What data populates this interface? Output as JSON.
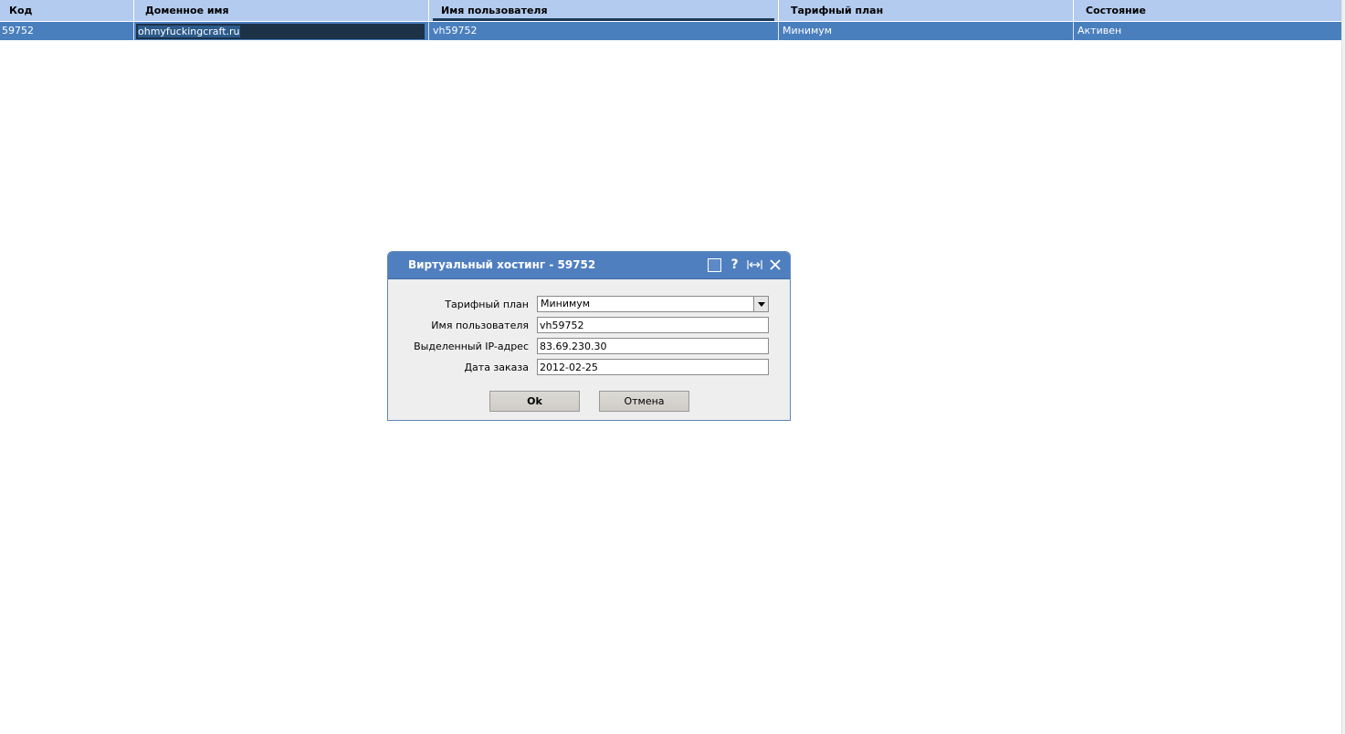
{
  "table": {
    "columns": [
      "Код",
      "Доменное имя",
      "Имя пользователя",
      "Тарифный план",
      "Состояние"
    ],
    "rows": [
      {
        "code": "59752",
        "domain": "ohmyfuckingcraft.ru",
        "username": "vh59752",
        "plan": "Минимум",
        "status": "Активен"
      }
    ]
  },
  "dialog": {
    "title": "Виртуальный хостинг - 59752",
    "tools": {
      "maximize_icon": "square-box-icon",
      "help_label": "?",
      "resize_label": "[↔]",
      "close_label": "✕"
    },
    "fields": {
      "plan_label": "Тарифный план",
      "plan_value": "Минимум",
      "username_label": "Имя пользователя",
      "username_value": "vh59752",
      "ip_label": "Выделенный IP-адрес",
      "ip_value": "83.69.230.30",
      "date_label": "Дата заказа",
      "date_value": "2012-02-25"
    },
    "buttons": {
      "ok_label": "Ok",
      "cancel_label": "Отмена"
    }
  },
  "colors": {
    "header_bg": "#b3cbee",
    "row_selected_bg": "#4a7fbe",
    "dialog_title_bg": "#4f7fbf",
    "dialog_body_bg": "#eeeeee"
  }
}
